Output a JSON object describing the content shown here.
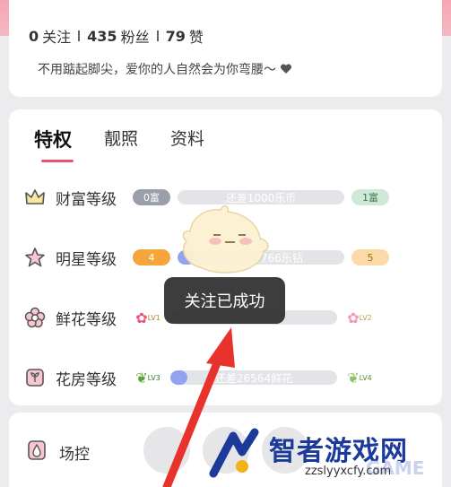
{
  "profile": {
    "follow_count": "0",
    "follow_label": "关注",
    "fans_count": "435",
    "fans_label": "粉丝",
    "likes_count": "79",
    "likes_label": "赞",
    "bio": "不用踮起脚尖，爱你的人自然会为你弯腰～",
    "bio_icon": "heart-icon"
  },
  "tabs": [
    {
      "label": "特权",
      "active": true
    },
    {
      "label": "靓照",
      "active": false
    },
    {
      "label": "资料",
      "active": false
    }
  ],
  "privileges": [
    {
      "label": "财富等级",
      "icon": "crown-icon",
      "current": "0富",
      "progress_text": "还差1000乐币",
      "progress": 0.0,
      "next": "1富"
    },
    {
      "label": "明星等级",
      "icon": "star-icon",
      "current": "4",
      "progress_text": "还差893766乐钻",
      "progress": 0.1,
      "next": "5"
    },
    {
      "label": "鲜花等级",
      "icon": "flower-icon",
      "current": "LV1",
      "progress_text": "",
      "progress": 0.0,
      "next": "LV2"
    },
    {
      "label": "花房等级",
      "icon": "greenhouse-icon",
      "current": "LV3",
      "progress_text": "还差26564鲜花",
      "progress": 0.1,
      "next": "LV4"
    }
  ],
  "toast": "关注已成功",
  "bottom": {
    "label": "场控",
    "icon": "drop-icon"
  },
  "watermark": {
    "title": "智者游戏网",
    "url": "zzslyyxcfy.com",
    "brand": "GAME"
  },
  "colors": {
    "accent": "#e9556f",
    "band": "#f6a6b6",
    "arrow": "#e8332c",
    "watermark": "#1b3a9a"
  }
}
